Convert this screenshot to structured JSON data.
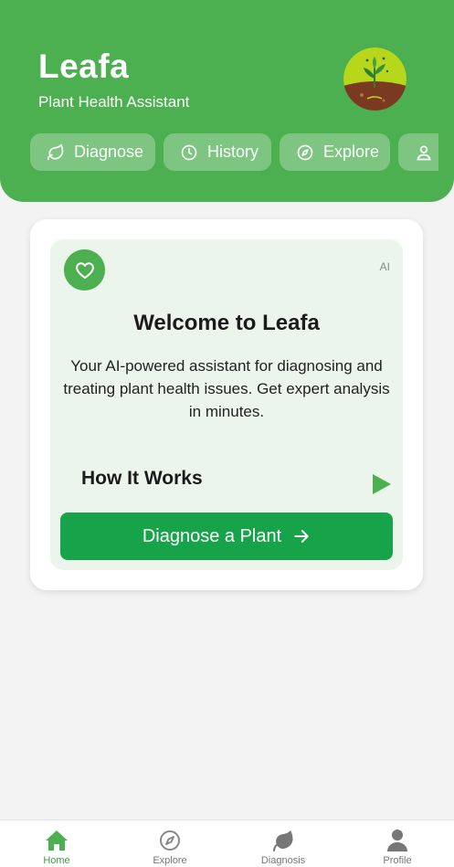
{
  "header": {
    "title": "Leafa",
    "subtitle": "Plant Health Assistant"
  },
  "nav_pills": [
    {
      "label": "Diagnose",
      "icon": "leaf-icon"
    },
    {
      "label": "History",
      "icon": "clock-icon"
    },
    {
      "label": "Explore",
      "icon": "compass-icon"
    },
    {
      "label": "",
      "icon": "user-icon"
    }
  ],
  "welcome_card": {
    "badge": "AI",
    "title": "Welcome to Leafa",
    "description": "Your AI-powered assistant for diagnosing and treating plant health issues. Get expert analysis in minutes.",
    "how_it_works": "How It Works",
    "cta_label": "Diagnose a Plant"
  },
  "bottom_nav": [
    {
      "label": "Home",
      "icon": "home-icon",
      "active": true
    },
    {
      "label": "Explore",
      "icon": "compass-icon",
      "active": false
    },
    {
      "label": "Diagnosis",
      "icon": "leaf-icon",
      "active": false
    },
    {
      "label": "Profile",
      "icon": "user-icon",
      "active": false
    }
  ],
  "colors": {
    "header_green": "#4caf50",
    "cta_green": "#17a34a",
    "card_tint": "#ebf5eb",
    "active_tab": "#3f9a43"
  }
}
